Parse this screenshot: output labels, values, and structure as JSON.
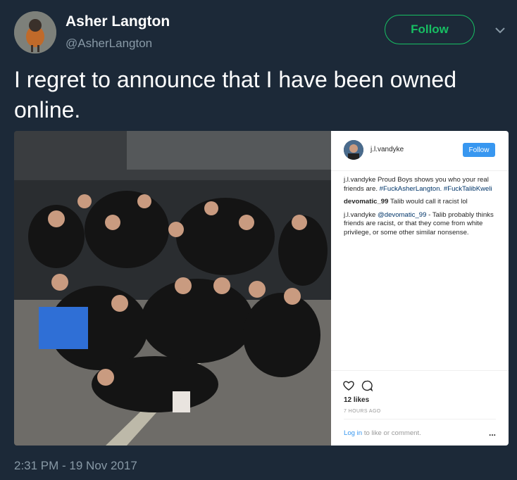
{
  "author": {
    "display_name": "Asher Langton",
    "handle": "@AsherLangton"
  },
  "follow_label": "Follow",
  "tweet": {
    "text": "I regret to announce that I have been owned online.",
    "timestamp": "2:31 PM - 19 Nov 2017"
  },
  "instagram": {
    "username": "j.l.vandyke",
    "follow_label": "Follow",
    "caption_user": "j.l.vandyke",
    "caption_text": "Proud Boys shows you who your real friends are.",
    "caption_tags": "#FuckAsherLangton. #FuckTalibKweli",
    "comment1_user": "devomatic_99",
    "comment1_text": "Talib would call it racist lol",
    "comment2_user": "j.l.vandyke",
    "comment2_mention": "@devomatic_99",
    "comment2_text": "- Talib probably thinks friends are racist, or that they come from white privilege, or some other similar nonsense.",
    "likes": "12 likes",
    "time": "7 HOURS AGO",
    "login_link": "Log in",
    "login_rest": "to like or comment.",
    "more": "..."
  },
  "colors": {
    "background": "#1c2938",
    "accent_green": "#17bf63",
    "muted": "#8899a6",
    "ig_blue": "#3897f0"
  },
  "icons": [
    "chevron-down-icon",
    "heart-icon",
    "comment-icon"
  ]
}
